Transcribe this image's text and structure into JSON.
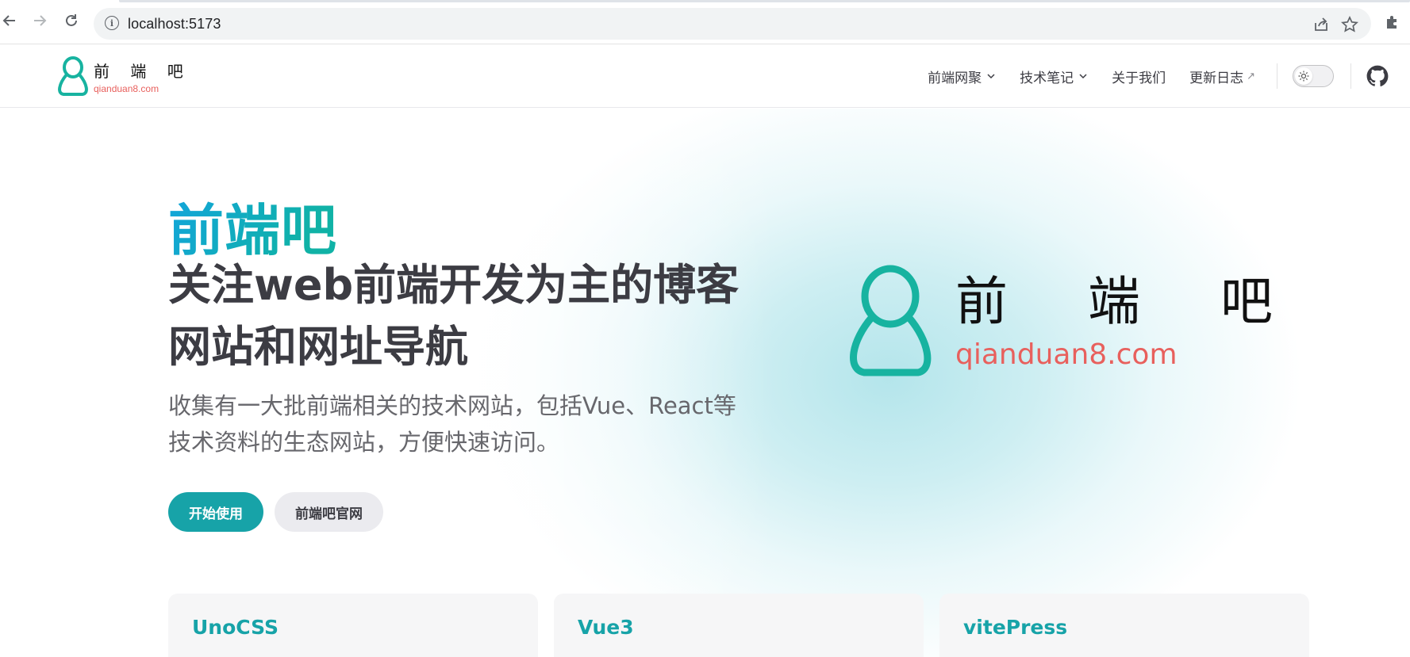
{
  "browser": {
    "url": "localhost:5173"
  },
  "site": {
    "logo_cn": "前 端 吧",
    "logo_en": "qianduan8.com",
    "nav": [
      {
        "label": "前端网聚",
        "has_dropdown": true
      },
      {
        "label": "技术笔记",
        "has_dropdown": true
      },
      {
        "label": "关于我们",
        "has_dropdown": false
      },
      {
        "label": "更新日志",
        "external": true
      }
    ],
    "ext_arrow": "↗",
    "caret": "⌄"
  },
  "hero": {
    "name": "前端吧",
    "text": "关注web前端开发为主的博客网站和网址导航",
    "tagline": "收集有一大批前端相关的技术网站，包括Vue、React等技术资料的生态网站，方便快速访问。",
    "actions": {
      "primary": "开始使用",
      "secondary": "前端吧官网"
    },
    "image_cn": "前 端 吧",
    "image_en": "qianduan8.com"
  },
  "features": [
    {
      "title": "UnoCSS",
      "details": ""
    },
    {
      "title": "Vue3",
      "details": ""
    },
    {
      "title": "vitePress",
      "details": ""
    }
  ],
  "colors": {
    "brand": "#17a3a8",
    "logo_red": "#e8605d",
    "logo_green": "#17b3a0"
  },
  "icons": [
    "back-arrow-icon",
    "forward-arrow-icon",
    "reload-icon",
    "info-icon",
    "share-icon",
    "star-icon",
    "extension-icon",
    "sun-icon",
    "github-icon"
  ]
}
